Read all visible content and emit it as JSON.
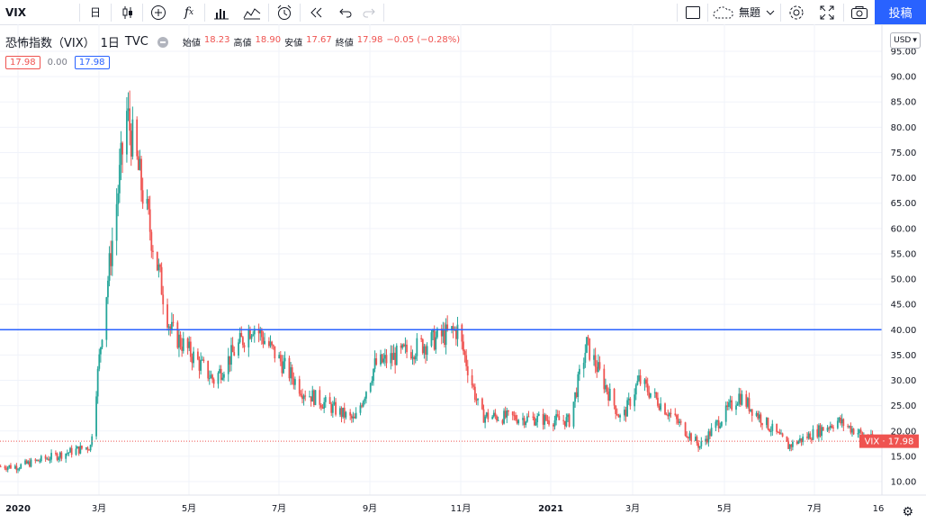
{
  "toolbar": {
    "symbol": "VIX",
    "interval": "日",
    "layout_name": "無題",
    "post_label": "投稿",
    "icons": [
      "candles-icon",
      "plus-circle-icon",
      "fx-icon",
      "bars-icon",
      "line-chart-icon",
      "alarm-icon",
      "replay-icon",
      "undo-icon",
      "redo-icon",
      "square-icon",
      "cloud-icon",
      "chevron-down-icon",
      "gear-icon",
      "fullscreen-icon",
      "camera-icon"
    ]
  },
  "legend": {
    "title": "恐怖指数（VIX）",
    "interval": "1日",
    "source": "TVC",
    "open_label": "始値",
    "open": "18.23",
    "high_label": "高値",
    "high": "18.90",
    "low_label": "安値",
    "low": "17.67",
    "close_label": "終値",
    "close": "17.98",
    "change": "−0.05 (−0.28%)"
  },
  "price_boxes": {
    "bid": "17.98",
    "spread": "0.00",
    "ask": "17.98"
  },
  "currency": "USD",
  "last_price_tag": {
    "symbol": "VIX",
    "price": "17.98"
  },
  "colors": {
    "up": "#26a69a",
    "down": "#ef5350",
    "hline": "#2962ff",
    "accent": "#2962ff"
  },
  "chart_data": {
    "type": "candlestick",
    "y_ticks": [
      "95.00",
      "90.00",
      "85.00",
      "80.00",
      "75.00",
      "70.00",
      "65.00",
      "60.00",
      "55.00",
      "50.00",
      "45.00",
      "40.00",
      "35.00",
      "30.00",
      "25.00",
      "20.00",
      "15.00",
      "10.00"
    ],
    "x_ticks": [
      "2020",
      "3月",
      "5月",
      "7月",
      "9月",
      "11月",
      "2021",
      "3月",
      "5月",
      "7月",
      "16"
    ],
    "horizontal_line": 40,
    "last_price": 17.98,
    "key_points": [
      {
        "date": "2020-01",
        "close": 13
      },
      {
        "date": "2020-02-20",
        "close": 17
      },
      {
        "date": "2020-02-28",
        "close": 40
      },
      {
        "date": "2020-03-16",
        "close": 82.7
      },
      {
        "date": "2020-04-15",
        "close": 40
      },
      {
        "date": "2020-05-15",
        "close": 30
      },
      {
        "date": "2020-06-11",
        "close": 41
      },
      {
        "date": "2020-07-15",
        "close": 28
      },
      {
        "date": "2020-08-20",
        "close": 22
      },
      {
        "date": "2020-09-03",
        "close": 33
      },
      {
        "date": "2020-10-30",
        "close": 40
      },
      {
        "date": "2020-11-15",
        "close": 23
      },
      {
        "date": "2021-01-15",
        "close": 22
      },
      {
        "date": "2021-01-27",
        "close": 37
      },
      {
        "date": "2021-02-20",
        "close": 22
      },
      {
        "date": "2021-03-04",
        "close": 30
      },
      {
        "date": "2021-04-15",
        "close": 17
      },
      {
        "date": "2021-05-12",
        "close": 27
      },
      {
        "date": "2021-06-15",
        "close": 17
      },
      {
        "date": "2021-07-19",
        "close": 22
      },
      {
        "date": "2021-08-13",
        "close": 17.98
      }
    ]
  }
}
